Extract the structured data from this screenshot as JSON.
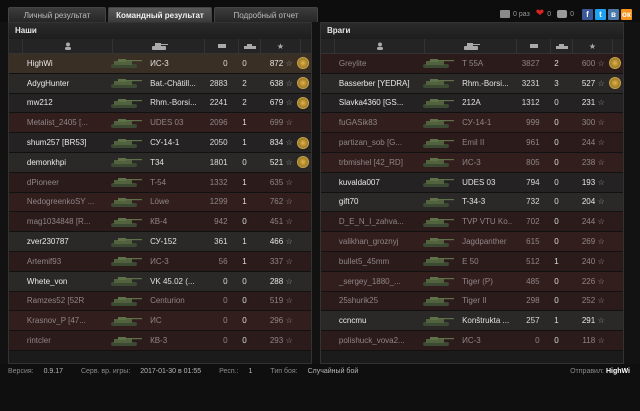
{
  "tabs": [
    {
      "label": "Личный результат",
      "active": false
    },
    {
      "label": "Командный результат",
      "active": true
    },
    {
      "label": "Подробный отчет",
      "active": false
    }
  ],
  "social": {
    "views": "0 раз",
    "likes": "0",
    "comments": "0",
    "buttons": [
      "f",
      "t",
      "в",
      "ок"
    ],
    "button_colors": [
      "#3b5998",
      "#1da1f2",
      "#4a76a8",
      "#f7931e"
    ]
  },
  "teams": {
    "allies": {
      "title": "Наши",
      "players": [
        {
          "name": "HighWi",
          "tank": "ИС-3",
          "damage": "0",
          "frags": "0",
          "xp": "872",
          "alive": true,
          "me": true,
          "medal": true
        },
        {
          "name": "AdygHunter",
          "tank": "Bat.-Châtill...",
          "damage": "2883",
          "frags": "2",
          "xp": "638",
          "alive": true,
          "medal": true
        },
        {
          "name": "mw212",
          "tank": "Rhm.-Borsi...",
          "damage": "2241",
          "frags": "2",
          "xp": "679",
          "alive": true,
          "medal": true
        },
        {
          "name": "Metalist_2405 [...",
          "tank": "UDES 03",
          "damage": "2096",
          "frags": "1",
          "xp": "699",
          "alive": false,
          "medal": false
        },
        {
          "name": "shum257 [BR53]",
          "tank": "СУ-14-1",
          "damage": "2050",
          "frags": "1",
          "xp": "834",
          "alive": true,
          "medal": true
        },
        {
          "name": "demonkhpi",
          "tank": "T34",
          "damage": "1801",
          "frags": "0",
          "xp": "521",
          "alive": true,
          "medal": true
        },
        {
          "name": "dPioneer",
          "tank": "T-54",
          "damage": "1332",
          "frags": "1",
          "xp": "635",
          "alive": false,
          "medal": false
        },
        {
          "name": "NedogreenkoSY ...",
          "tank": "Löwe",
          "damage": "1299",
          "frags": "1",
          "xp": "762",
          "alive": false,
          "medal": false
        },
        {
          "name": "mag1034848 [R...",
          "tank": "КВ-4",
          "damage": "942",
          "frags": "0",
          "xp": "451",
          "alive": false,
          "medal": false
        },
        {
          "name": "zver230787",
          "tank": "СУ-152",
          "damage": "361",
          "frags": "1",
          "xp": "466",
          "alive": true,
          "medal": false
        },
        {
          "name": "Artemif93",
          "tank": "ИС-3",
          "damage": "56",
          "frags": "1",
          "xp": "337",
          "alive": false,
          "medal": false
        },
        {
          "name": "Whete_von",
          "tank": "VK 45.02 (...",
          "damage": "0",
          "frags": "0",
          "xp": "288",
          "alive": true,
          "medal": false
        },
        {
          "name": "Ramzes52 [52R",
          "tank": "Centurion",
          "damage": "0",
          "frags": "0",
          "xp": "519",
          "alive": false,
          "medal": false
        },
        {
          "name": "Krasnov_P [47...",
          "tank": "ИС",
          "damage": "0",
          "frags": "0",
          "xp": "296",
          "alive": false,
          "medal": false
        },
        {
          "name": "rintcler",
          "tank": "КВ-3",
          "damage": "0",
          "frags": "0",
          "xp": "293",
          "alive": false,
          "medal": false
        }
      ]
    },
    "enemies": {
      "title": "Враги",
      "players": [
        {
          "name": "Greylite",
          "tank": "T 55A",
          "damage": "3827",
          "frags": "2",
          "xp": "600",
          "alive": false,
          "medal": true
        },
        {
          "name": "Basserber [YEDRA]",
          "tank": "Rhm.-Borsi...",
          "damage": "3231",
          "frags": "3",
          "xp": "527",
          "alive": true,
          "medal": true
        },
        {
          "name": "Slavka4360 [GS...",
          "tank": "212A",
          "damage": "1312",
          "frags": "0",
          "xp": "231",
          "alive": true,
          "medal": false
        },
        {
          "name": "fuGASik83",
          "tank": "СУ-14-1",
          "damage": "999",
          "frags": "0",
          "xp": "300",
          "alive": false,
          "medal": false
        },
        {
          "name": "partizan_sob [G...",
          "tank": "Emil II",
          "damage": "961",
          "frags": "0",
          "xp": "244",
          "alive": false,
          "medal": false
        },
        {
          "name": "trbmishel [42_RD]",
          "tank": "ИС-3",
          "damage": "805",
          "frags": "0",
          "xp": "238",
          "alive": false,
          "medal": false
        },
        {
          "name": "kuvalda007",
          "tank": "UDES 03",
          "damage": "794",
          "frags": "0",
          "xp": "193",
          "alive": true,
          "medal": false
        },
        {
          "name": "gift70",
          "tank": "T-34-3",
          "damage": "732",
          "frags": "0",
          "xp": "204",
          "alive": true,
          "medal": false
        },
        {
          "name": "D_E_N_I_zahva...",
          "tank": "TVP VTU Ko...",
          "damage": "702",
          "frags": "0",
          "xp": "244",
          "alive": false,
          "medal": false
        },
        {
          "name": "valikhan_groznyj",
          "tank": "Jagdpanther",
          "damage": "615",
          "frags": "0",
          "xp": "269",
          "alive": false,
          "medal": false
        },
        {
          "name": "bullet5_45mm",
          "tank": "E 50",
          "damage": "512",
          "frags": "1",
          "xp": "240",
          "alive": false,
          "medal": false
        },
        {
          "name": "_sergey_1880_...",
          "tank": "Tiger (P)",
          "damage": "485",
          "frags": "0",
          "xp": "226",
          "alive": false,
          "medal": false
        },
        {
          "name": "25shurik25",
          "tank": "Tiger II",
          "damage": "298",
          "frags": "0",
          "xp": "252",
          "alive": false,
          "medal": false
        },
        {
          "name": "ccncmu",
          "tank": "Konštrukta ...",
          "damage": "257",
          "frags": "1",
          "xp": "291",
          "alive": true,
          "medal": false
        },
        {
          "name": "polishuck_vova2...",
          "tank": "ИС-3",
          "damage": "0",
          "frags": "0",
          "xp": "118",
          "alive": false,
          "medal": false
        }
      ]
    }
  },
  "footer": {
    "version_label": "Версия:",
    "version": "0.9.17",
    "server_time_label": "Серв. вр. игры:",
    "server_time": "2017-01-30 в 01:55",
    "respawn_label": "Респ.:",
    "respawn": "1",
    "battle_type_label": "Тип боя:",
    "battle_type": "Случайный бой",
    "sender_label": "Отправил:",
    "sender": "HighWi"
  }
}
